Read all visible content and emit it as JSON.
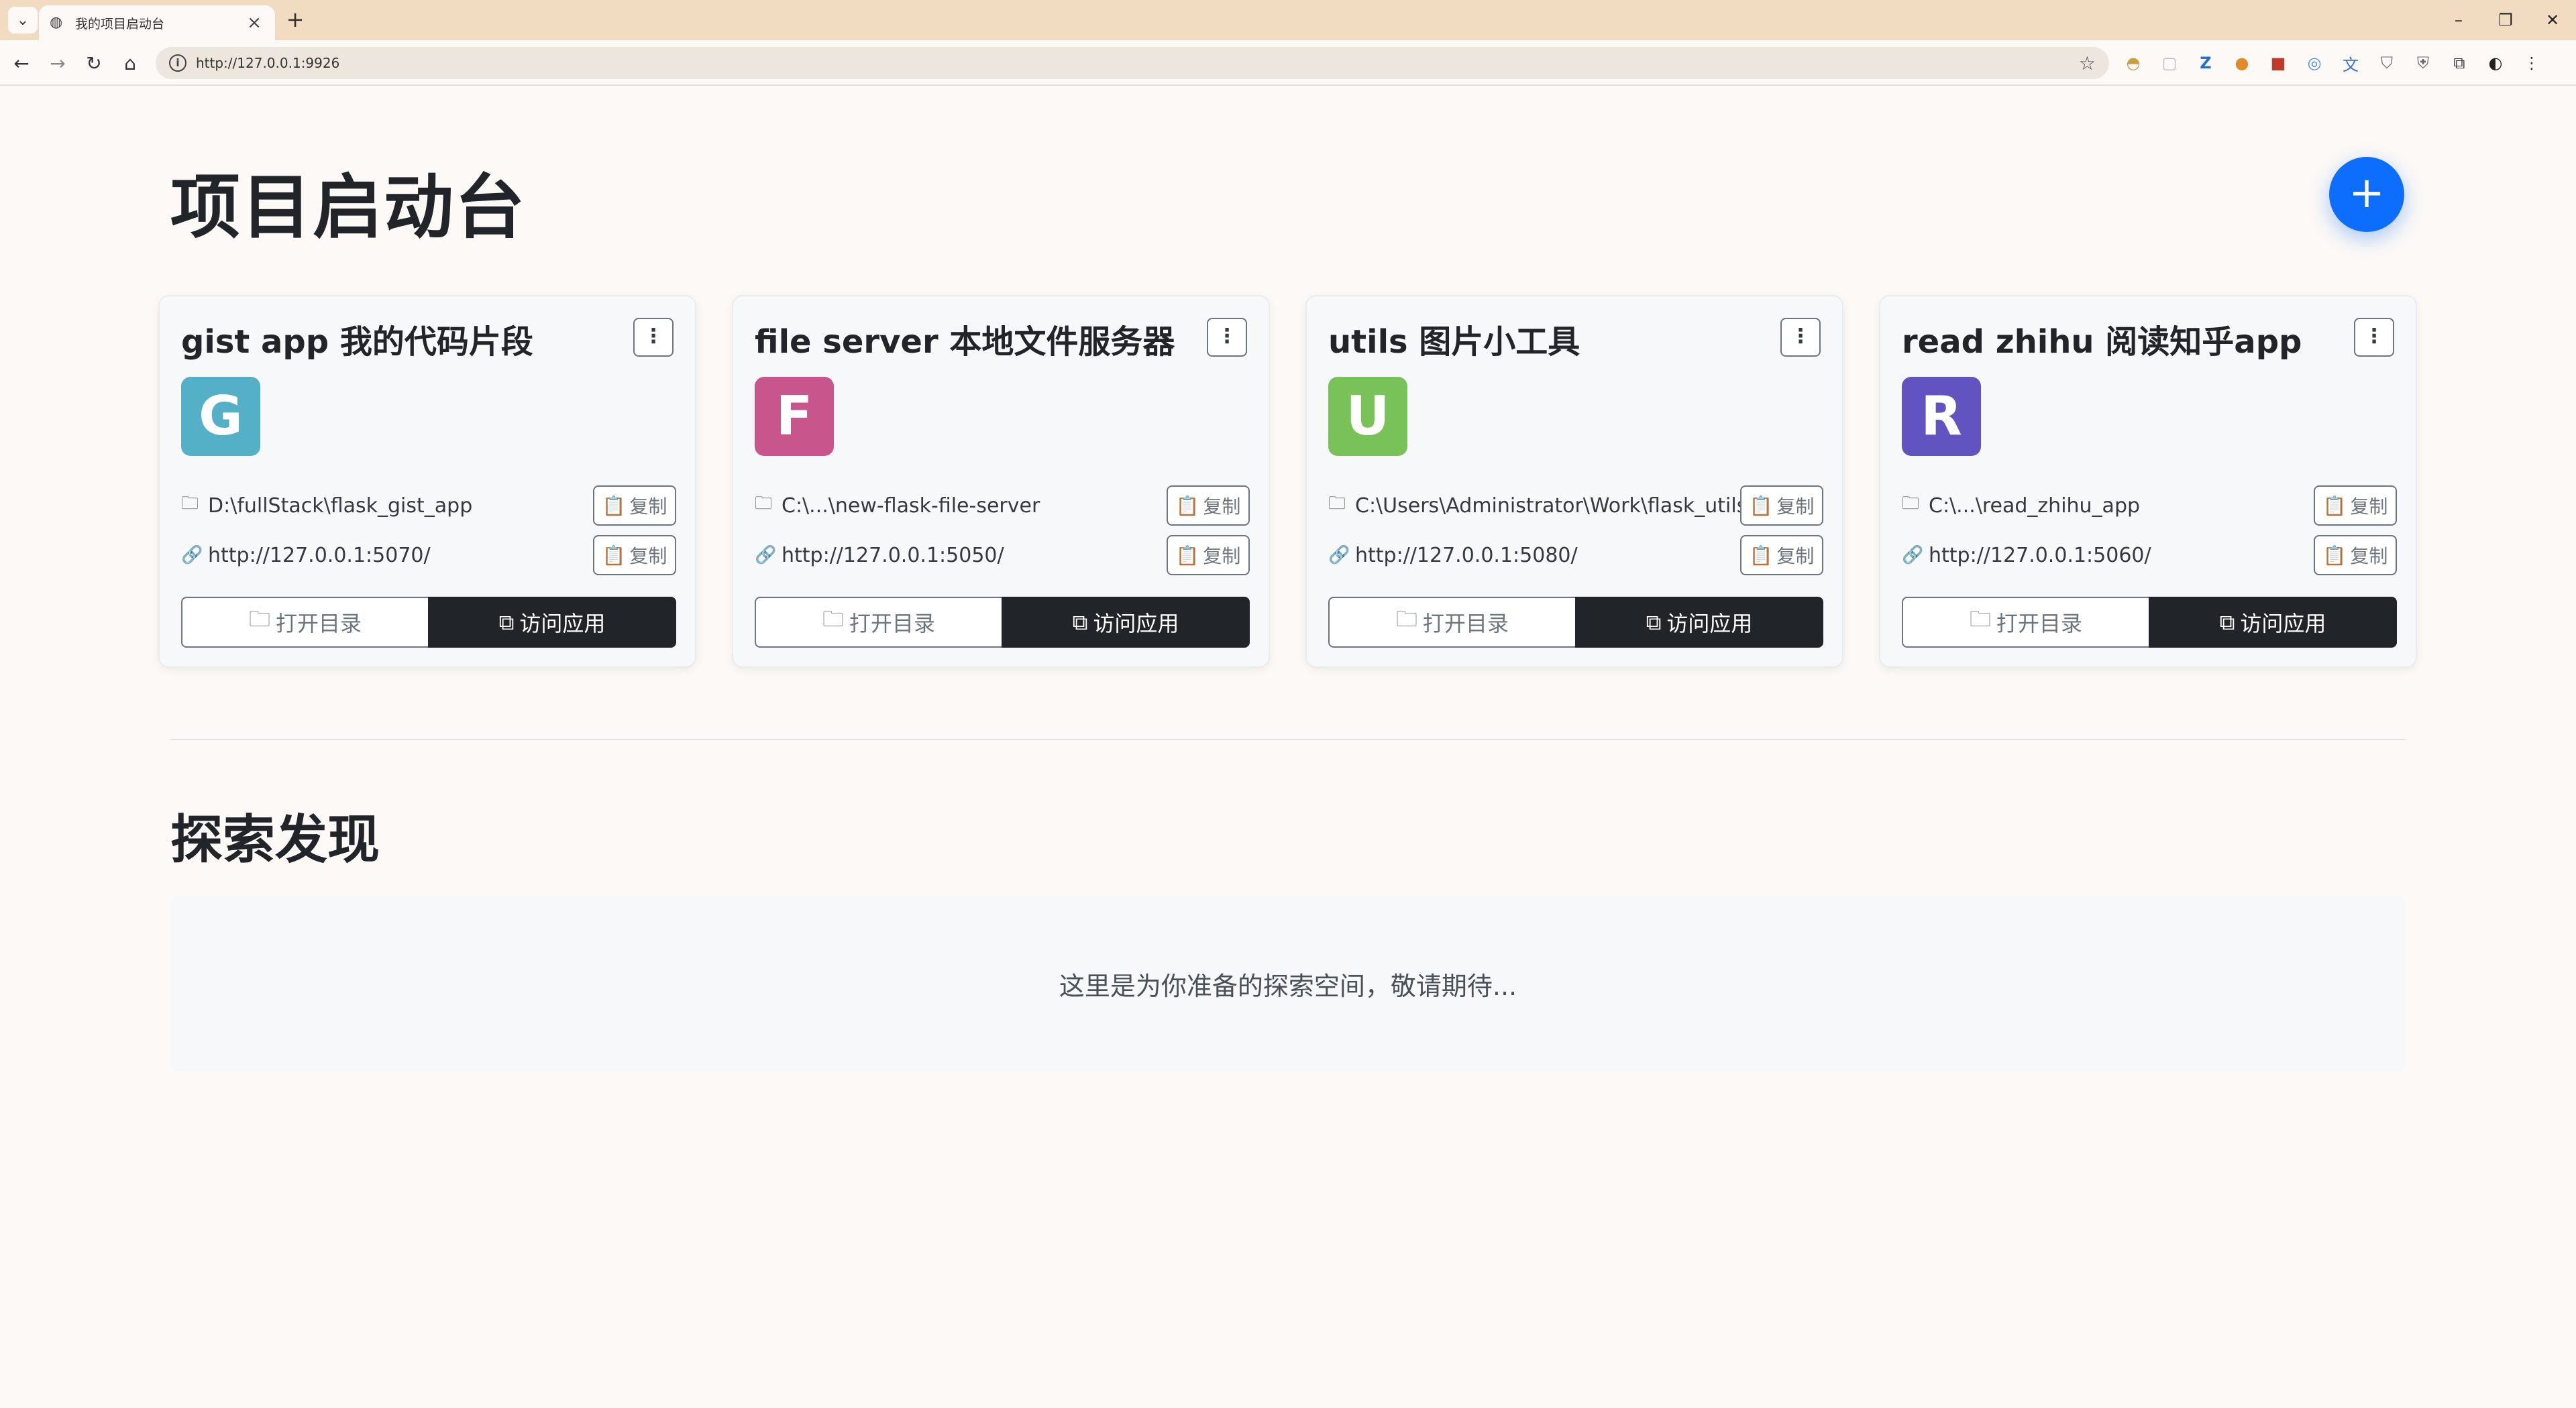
{
  "browser": {
    "tab_title": "我的项目启动台",
    "url": "http://127.0.0.1:9926",
    "tab_close": "×",
    "new_tab": "+",
    "window_controls": [
      "–",
      "❐",
      "✕"
    ]
  },
  "header": {
    "title": "项目启动台",
    "add_button": "+"
  },
  "projects": [
    {
      "title": "gist app 我的代码片段",
      "initial": "G",
      "color": "#54b0c6",
      "path": "D:\\fullStack\\flask_gist_app",
      "url": "http://127.0.0.1:5070/"
    },
    {
      "title": "file server 本地文件服务器",
      "initial": "F",
      "color": "#c9558d",
      "path": "C:\\...\\new-flask-file-server",
      "url": "http://127.0.0.1:5050/"
    },
    {
      "title": "utils 图片小工具",
      "initial": "U",
      "color": "#78c259",
      "path": "C:\\Users\\Administrator\\Work\\flask_utils",
      "url": "http://127.0.0.1:5080/"
    },
    {
      "title": "read zhihu 阅读知乎app",
      "initial": "R",
      "color": "#6254c0",
      "path": "C:\\...\\read_zhihu_app",
      "url": "http://127.0.0.1:5060/"
    }
  ],
  "labels": {
    "copy": "复制",
    "open_dir": "打开目录",
    "visit_app": "访问应用",
    "kebab": "⋮"
  },
  "explore": {
    "title": "探索发现",
    "message": "这里是为你准备的探索空间，敬请期待..."
  }
}
